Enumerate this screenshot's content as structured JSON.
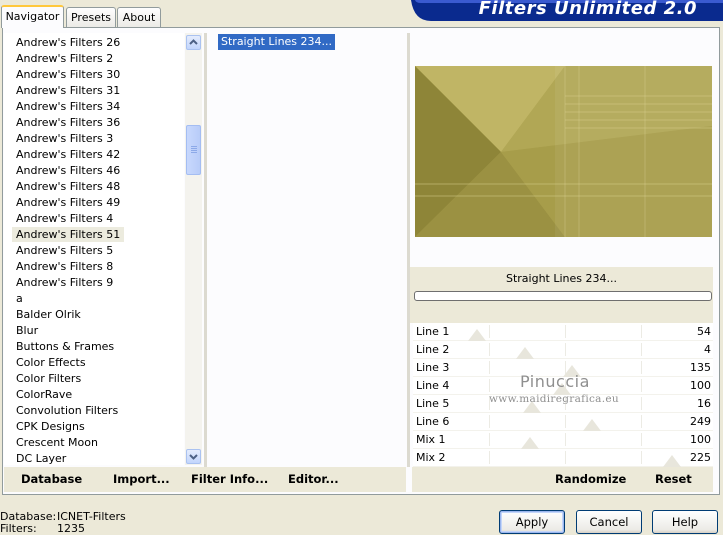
{
  "tabs": [
    "Navigator",
    "Presets",
    "About"
  ],
  "banner_title": "Filters Unlimited 2.0",
  "filter_list": {
    "items": [
      "Andrew's Filters 26",
      "Andrew's Filters 2",
      "Andrew's Filters 30",
      "Andrew's Filters 31",
      "Andrew's Filters 34",
      "Andrew's Filters 36",
      "Andrew's Filters 3",
      "Andrew's Filters 42",
      "Andrew's Filters 46",
      "Andrew's Filters 48",
      "Andrew's Filters 49",
      "Andrew's Filters 4",
      "Andrew's Filters 51",
      "Andrew's Filters 5",
      "Andrew's Filters 8",
      "Andrew's Filters 9",
      "a",
      "Balder Olrik",
      "Blur",
      "Buttons & Frames",
      "Color Effects",
      "Color Filters",
      "ColorRave",
      "Convolution Filters",
      "CPK Designs",
      "Crescent Moon",
      "DC Layer"
    ],
    "selected_index": 12
  },
  "effect_list": {
    "items": [
      "Straight Lines 234..."
    ]
  },
  "preview_filter_name": "Straight Lines 234...",
  "parameters": [
    {
      "label": "Line 1",
      "value": "54"
    },
    {
      "label": "Line 2",
      "value": "4"
    },
    {
      "label": "Line 3",
      "value": "135"
    },
    {
      "label": "Line 4",
      "value": "100"
    },
    {
      "label": "Line 5",
      "value": "16"
    },
    {
      "label": "Line 6",
      "value": "249"
    },
    {
      "label": "Mix 1",
      "value": "100"
    },
    {
      "label": "Mix 2",
      "value": "225"
    }
  ],
  "bottom_buttons": {
    "database": "Database",
    "import": "Import...",
    "filter_info": "Filter Info...",
    "editor": "Editor...",
    "randomize": "Randomize",
    "reset": "Reset"
  },
  "watermark": {
    "name": "Pinuccia",
    "url": "www.maidiregrafica.eu"
  },
  "status": {
    "database_label": "Database:",
    "database_value": "ICNET-Filters",
    "filters_label": "Filters:",
    "filters_value": "1235"
  },
  "dialog_buttons": {
    "apply": "Apply",
    "cancel": "Cancel",
    "help": "Help"
  },
  "colors": {
    "selection": "#316ac5",
    "preview_olive": "#a49a48",
    "banner_blue": "#0a2a8e",
    "window_bg": "#ece9d8"
  }
}
